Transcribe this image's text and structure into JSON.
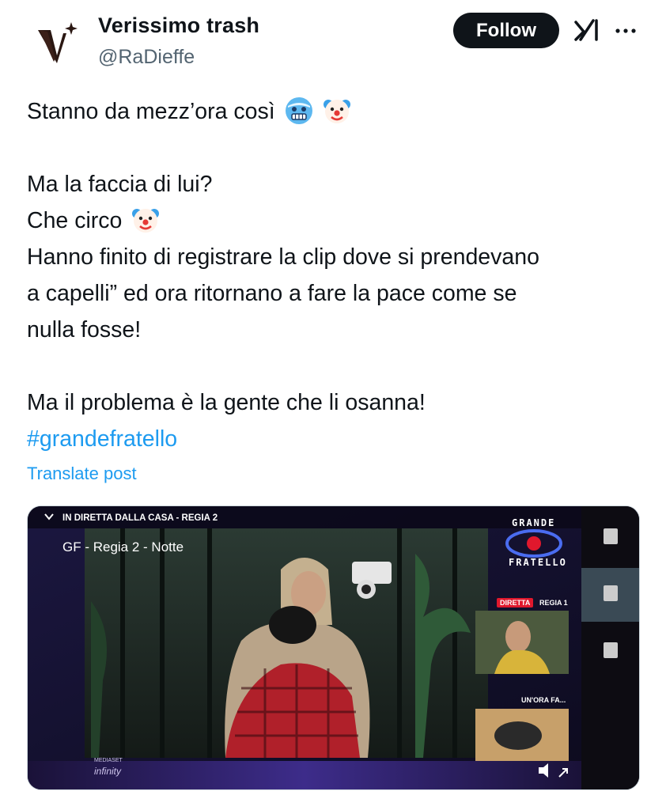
{
  "author": {
    "name": "Verissimo trash",
    "handle": "@RaDieffe",
    "avatar_icon": "v-logo-avatar"
  },
  "header": {
    "follow_label": "Follow",
    "x_logo_icon": "grok-icon",
    "more_icon": "more-dots-icon"
  },
  "tweet": {
    "line1": "Stanno da mezz’ora così",
    "line1_emojis": [
      "cold-face-emoji",
      "clown-face-emoji"
    ],
    "line2": "Ma la faccia di lui?",
    "line3": "Che circo",
    "line3_emoji": "clown-face-emoji",
    "line4": "Hanno finito di registrare la clip dove si prendevano",
    "line5": "a capelli” ed ora ritornano a fare la pace come se",
    "line6": "nulla fosse!",
    "line7": "Ma il problema è la gente che li osanna!",
    "hashtag": "#grandefratello",
    "translate_label": "Translate post"
  },
  "media": {
    "top_label": "IN DIRETTA DALLA CASA - REGIA 2",
    "channel_title": "GF - Regia 2 - Notte",
    "brand_line1": "GRANDE",
    "brand_line2": "FRATELLO",
    "live_badge": "DIRETTA",
    "live_channel": "REGIA 1",
    "hour_ago_label": "UN'ORA FA...",
    "watermark_line1": "MEDIASET",
    "watermark_line2": "infinity",
    "colors": {
      "accent_purple": "#3a2a7a",
      "live_red": "#e0182d"
    }
  },
  "colors": {
    "text": "#0f1419",
    "secondary": "#536471",
    "link": "#1d9bf0",
    "button_bg": "#0f1419"
  }
}
